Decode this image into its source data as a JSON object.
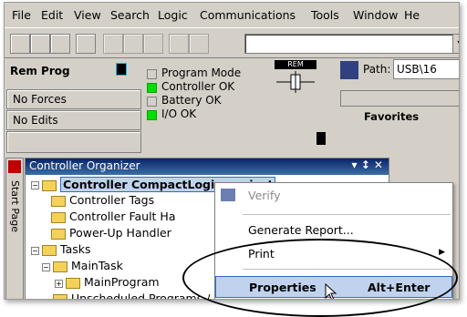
{
  "menubar": {
    "items": [
      "File",
      "Edit",
      "View",
      "Search",
      "Logic",
      "Communications",
      "Tools",
      "Window",
      "He"
    ]
  },
  "status": {
    "mode_label": "Rem Prog",
    "forces_label": "No Forces",
    "edits_label": "No Edits",
    "indicators": [
      {
        "label": "Program Mode",
        "on": false
      },
      {
        "label": "Controller OK",
        "on": true
      },
      {
        "label": "Battery OK",
        "on": false
      },
      {
        "label": "I/O OK",
        "on": true
      }
    ],
    "rem_label": "REM",
    "path_label": "Path:",
    "path_value": "USB\\16",
    "favorites_tab": "Favorites"
  },
  "organizer": {
    "title": "Controller Organizer",
    "title_controls": "▾ p ×",
    "side_tab": "Start Page",
    "tree": [
      {
        "label": "Controller CompactLogix_project",
        "selected": true
      },
      {
        "label": "Controller Tags"
      },
      {
        "label": "Controller Fault Ha"
      },
      {
        "label": "Power-Up Handler"
      },
      {
        "label": "Tasks"
      },
      {
        "label": "MainTask"
      },
      {
        "label": "MainProgram"
      },
      {
        "label": "Unscheduled Programs / Phases"
      }
    ]
  },
  "context_menu": {
    "verify": "Verify",
    "generate_report": "Generate Report...",
    "print": "Print",
    "properties": "Properties",
    "properties_shortcut": "Alt+Enter"
  }
}
